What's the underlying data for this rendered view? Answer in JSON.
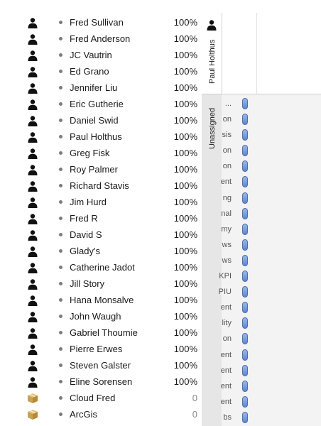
{
  "resources": [
    {
      "name": "Fred Sullivan",
      "pct": "100%",
      "type": "person"
    },
    {
      "name": "Fred Anderson",
      "pct": "100%",
      "type": "person"
    },
    {
      "name": "JC Vautrin",
      "pct": "100%",
      "type": "person"
    },
    {
      "name": "Ed Grano",
      "pct": "100%",
      "type": "person"
    },
    {
      "name": "Jennifer Liu",
      "pct": "100%",
      "type": "person"
    },
    {
      "name": "Eric Gutherie",
      "pct": "100%",
      "type": "person"
    },
    {
      "name": "Daniel Swid",
      "pct": "100%",
      "type": "person"
    },
    {
      "name": "Paul Holthus",
      "pct": "100%",
      "type": "person"
    },
    {
      "name": "Greg Fisk",
      "pct": "100%",
      "type": "person"
    },
    {
      "name": "Roy Palmer",
      "pct": "100%",
      "type": "person"
    },
    {
      "name": "Richard Stavis",
      "pct": "100%",
      "type": "person"
    },
    {
      "name": "Jim Hurd",
      "pct": "100%",
      "type": "person"
    },
    {
      "name": "Fred R",
      "pct": "100%",
      "type": "person"
    },
    {
      "name": "David S",
      "pct": "100%",
      "type": "person"
    },
    {
      "name": "Glady's",
      "pct": "100%",
      "type": "person"
    },
    {
      "name": "Catherine Jadot",
      "pct": "100%",
      "type": "person"
    },
    {
      "name": "Jill Story",
      "pct": "100%",
      "type": "person"
    },
    {
      "name": "Hana Monsalve",
      "pct": "100%",
      "type": "person"
    },
    {
      "name": "John Waugh",
      "pct": "100%",
      "type": "person"
    },
    {
      "name": "Gabriel Thoumie",
      "pct": "100%",
      "type": "person"
    },
    {
      "name": "Pierre Erwes",
      "pct": "100%",
      "type": "person"
    },
    {
      "name": "Steven Galster",
      "pct": "100%",
      "type": "person"
    },
    {
      "name": "Eline Sorensen",
      "pct": "100%",
      "type": "person"
    },
    {
      "name": "Cloud Fred",
      "pct": "0",
      "type": "material"
    },
    {
      "name": "ArcGis",
      "pct": "0",
      "type": "material"
    }
  ],
  "columns": {
    "paul_holthus": "Paul Holthus",
    "unassigned": "Unassigned"
  },
  "tasks": [
    "...",
    "on",
    "sis",
    "on",
    "on",
    "ent",
    "ng",
    "nal",
    "my",
    "ws",
    "ws",
    "KPI",
    "PIU",
    "ent",
    "lity",
    "on",
    "ent",
    "ent",
    "ent",
    "ent",
    "bs"
  ],
  "colors": {
    "pill": "#6f97dd",
    "divider": "#cfcfcf"
  }
}
